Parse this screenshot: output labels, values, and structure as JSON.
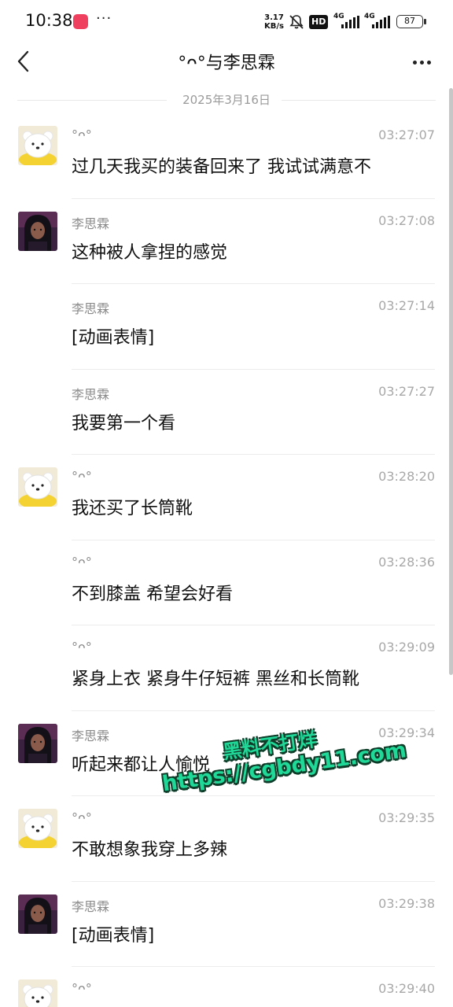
{
  "status_bar": {
    "time": "10:38",
    "more": "···",
    "speed_value": "3.17",
    "speed_unit": "KB/s",
    "hd_label": "HD",
    "network1": "4G",
    "network2": "4G",
    "battery": "87",
    "icons": [
      "app-notification-icon",
      "bell-muted-icon",
      "signal-icon",
      "battery-icon"
    ]
  },
  "header": {
    "title": "°ᴖ°与李思霖",
    "back_icon": "chevron-left-icon",
    "more_icon": "more-horizontal-icon"
  },
  "date_divider": "2025年3月16日",
  "messages": [
    {
      "sender": "°ᴖ°",
      "time": "03:27:07",
      "text": "过几天我买的装备回来了 我试试满意不",
      "avatar": "bear"
    },
    {
      "sender": "李思霖",
      "time": "03:27:08",
      "text": "这种被人拿捏的感觉",
      "avatar": "girl"
    },
    {
      "sender": "李思霖",
      "time": "03:27:14",
      "text": "[动画表情]",
      "avatar": ""
    },
    {
      "sender": "李思霖",
      "time": "03:27:27",
      "text": "我要第一个看",
      "avatar": ""
    },
    {
      "sender": "°ᴖ°",
      "time": "03:28:20",
      "text": "我还买了长筒靴",
      "avatar": "bear"
    },
    {
      "sender": "°ᴖ°",
      "time": "03:28:36",
      "text": "不到膝盖 希望会好看",
      "avatar": ""
    },
    {
      "sender": "°ᴖ°",
      "time": "03:29:09",
      "text": "紧身上衣 紧身牛仔短裤 黑丝和长筒靴",
      "avatar": ""
    },
    {
      "sender": "李思霖",
      "time": "03:29:34",
      "text": "听起来都让人愉悦",
      "avatar": "girl"
    },
    {
      "sender": "°ᴖ°",
      "time": "03:29:35",
      "text": "不敢想象我穿上多辣",
      "avatar": "bear"
    },
    {
      "sender": "李思霖",
      "time": "03:29:38",
      "text": "[动画表情]",
      "avatar": "girl"
    },
    {
      "sender": "°ᴖ°",
      "time": "03:29:40",
      "text": "",
      "avatar": "bear"
    }
  ],
  "watermark": {
    "line1": "黑料不打烊",
    "line2": "https://cgbdy11.com"
  },
  "colors": {
    "watermark_fill": "#20d898",
    "watermark_outline": "#0e3d2a",
    "timestamp": "#a8a8a8",
    "sender": "#8a8a8a"
  }
}
